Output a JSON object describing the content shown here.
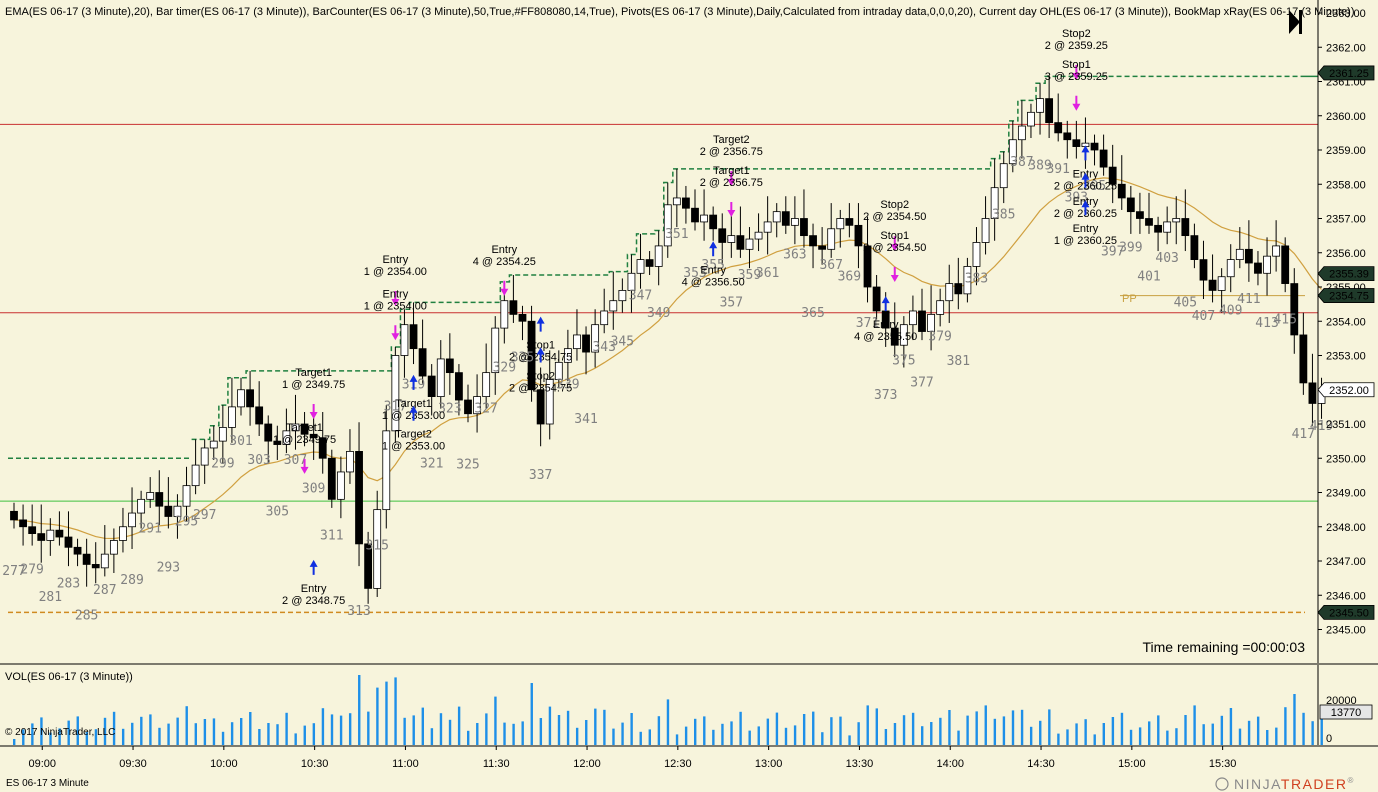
{
  "header": {
    "indicators": "EMA(ES 06-17 (3 Minute),20), Bar timer(ES 06-17 (3 Minute)), BarCounter(ES 06-17 (3 Minute),50,True,#FF808080,14,True), Pivots(ES 06-17 (3 Minute),Daily,Calculated from intraday data,0,0,0,20), Current day OHL(ES 06-17 (3 Minute)), BookMap xRay(ES 06-17 (3 Minute))"
  },
  "time_remaining": "Time remaining =00:00:03",
  "volume_panel": {
    "label": "VOL(ES 06-17 (3 Minute))",
    "current_tag": "13770",
    "ticks": [
      "20000",
      "0"
    ]
  },
  "copyright": "© 2017 NinjaTrader, LLC",
  "instrument_label": "ES 06-17  3 Minute",
  "brand": {
    "ninja": "NINJA",
    "trader": "TRADER",
    "reg": "®"
  },
  "pivot_label": "PP",
  "price_tags": [
    {
      "text": "2361.25",
      "price": 2361.25,
      "style": "dark"
    },
    {
      "text": "2355.39",
      "price": 2355.39,
      "style": "dark"
    },
    {
      "text": "2354.75",
      "price": 2354.75,
      "style": "dark"
    },
    {
      "text": "2352.00",
      "price": 2352.0,
      "style": "light"
    },
    {
      "text": "2345.50",
      "price": 2345.5,
      "style": "dark"
    }
  ],
  "chart_data": {
    "type": "candlestick",
    "instrument": "ES 06-17",
    "interval": "3 Minute",
    "ylim": [
      2344.6,
      2363.3
    ],
    "y_ticks": [
      "2345.00",
      "2346.00",
      "2347.00",
      "2348.00",
      "2349.00",
      "2350.00",
      "2351.00",
      "2352.00",
      "2353.00",
      "2354.00",
      "2355.00",
      "2356.00",
      "2357.00",
      "2358.00",
      "2359.00",
      "2360.00",
      "2361.00",
      "2362.00",
      "2363.00"
    ],
    "x_ticks": [
      "09:00",
      "09:30",
      "10:00",
      "10:30",
      "11:00",
      "11:30",
      "12:00",
      "12:30",
      "13:00",
      "13:30",
      "14:00",
      "14:30",
      "15:00",
      "15:30"
    ],
    "x_tick_bar_index": [
      3,
      13,
      23,
      33,
      43,
      53,
      63,
      73,
      83,
      93,
      103,
      113,
      123,
      133
    ],
    "reference_lines": {
      "day_high": 2361.25,
      "day_low": 2345.5,
      "day_open": 2350.0,
      "pivot_pp": 2354.75,
      "red_upper": 2359.75,
      "red_lower": 2354.25,
      "green": 2348.75
    },
    "price_series": [
      2348.2,
      2348.0,
      2347.8,
      2347.6,
      2347.9,
      2347.7,
      2347.4,
      2347.2,
      2346.9,
      2346.8,
      2347.2,
      2347.6,
      2348.0,
      2348.4,
      2348.8,
      2349.0,
      2348.6,
      2348.3,
      2348.6,
      2349.2,
      2349.8,
      2350.3,
      2350.5,
      2350.9,
      2351.5,
      2352.0,
      2351.5,
      2351.0,
      2350.5,
      2350.4,
      2350.8,
      2351.0,
      2350.7,
      2350.6,
      2350.0,
      2348.8,
      2349.6,
      2350.2,
      2347.5,
      2346.2,
      2348.5,
      2350.8,
      2353.0,
      2353.9,
      2353.2,
      2352.4,
      2351.8,
      2352.9,
      2352.5,
      2351.7,
      2351.3,
      2351.8,
      2352.5,
      2353.8,
      2354.6,
      2354.2,
      2354.0,
      2352.0,
      2351.0,
      2352.3,
      2352.8,
      2353.2,
      2353.6,
      2353.1,
      2353.9,
      2354.3,
      2354.6,
      2354.9,
      2355.4,
      2355.8,
      2355.6,
      2356.2,
      2357.4,
      2357.6,
      2357.3,
      2356.9,
      2357.1,
      2356.7,
      2356.3,
      2356.5,
      2356.1,
      2356.4,
      2356.6,
      2356.9,
      2357.2,
      2356.8,
      2357.0,
      2356.5,
      2356.2,
      2356.1,
      2356.7,
      2357.0,
      2356.8,
      2356.2,
      2355.0,
      2354.3,
      2353.8,
      2353.3,
      2353.9,
      2354.3,
      2353.7,
      2354.2,
      2354.6,
      2355.1,
      2354.8,
      2355.6,
      2356.3,
      2357.0,
      2357.9,
      2358.6,
      2359.3,
      2359.7,
      2360.1,
      2360.5,
      2359.8,
      2359.5,
      2359.3,
      2359.1,
      2359.2,
      2359.0,
      2358.5,
      2358.0,
      2357.6,
      2357.2,
      2357.0,
      2356.8,
      2356.6,
      2356.9,
      2357.0,
      2356.5,
      2355.8,
      2355.2,
      2354.9,
      2355.3,
      2355.8,
      2356.1,
      2355.7,
      2355.4,
      2355.9,
      2356.2,
      2355.1,
      2353.6,
      2352.2,
      2351.6,
      2352.0
    ],
    "bar_counter_labels": [
      "277",
      "279",
      "281",
      "283",
      "285",
      "287",
      "289",
      "291",
      "293",
      "295",
      "297",
      "299",
      "301",
      "303",
      "305",
      "307",
      "309",
      "311",
      "313",
      "315",
      "317",
      "319",
      "321",
      "323",
      "325",
      "327",
      "329",
      "335",
      "337",
      "339",
      "341",
      "343",
      "345",
      "347",
      "349",
      "351",
      "353",
      "355",
      "357",
      "359",
      "361",
      "363",
      "365",
      "367",
      "369",
      "371",
      "373",
      "375",
      "377",
      "379",
      "381",
      "383",
      "385",
      "387",
      "389",
      "391",
      "393",
      "395",
      "397",
      "399",
      "401",
      "403",
      "405",
      "407",
      "409",
      "411",
      "413",
      "415",
      "417",
      "419"
    ],
    "ema": "EMA(20)",
    "annotations": [
      {
        "text": "Entry\n2 @ 2348.75",
        "price": 2346.1,
        "bar": 33,
        "dir": "long-entry"
      },
      {
        "text": "Target1\n1 @ 2349.75",
        "price": 2352.4,
        "bar": 33,
        "dir": "short-exit"
      },
      {
        "text": "Target1\n1 @ 2349.75",
        "price": 2350.8,
        "bar": 32,
        "dir": "short-exit"
      },
      {
        "text": "Entry\n1 @ 2354.00",
        "price": 2355.7,
        "bar": 42,
        "dir": "short-entry"
      },
      {
        "text": "Entry\n1 @ 2354.00",
        "price": 2354.7,
        "bar": 42,
        "dir": "short-entry"
      },
      {
        "text": "Target1\n1 @ 2353.00",
        "price": 2351.5,
        "bar": 44,
        "dir": "long-exit"
      },
      {
        "text": "Target2\n1 @ 2353.00",
        "price": 2350.6,
        "bar": 44,
        "dir": "long-exit"
      },
      {
        "text": "Entry\n4 @ 2354.25",
        "price": 2356.0,
        "bar": 54,
        "dir": "short-entry"
      },
      {
        "text": "Stop1\n2 @ 2354.75",
        "price": 2353.2,
        "bar": 58,
        "dir": "long-exit"
      },
      {
        "text": "Stop2\n2 @ 2354.75",
        "price": 2352.3,
        "bar": 58,
        "dir": "long-exit"
      },
      {
        "text": "Target2\n2 @ 2356.75",
        "price": 2359.2,
        "bar": 79,
        "dir": "short-exit"
      },
      {
        "text": "Target1\n2 @ 2356.75",
        "price": 2358.3,
        "bar": 79,
        "dir": "short-exit"
      },
      {
        "text": "Entry\n4 @ 2356.50",
        "price": 2355.4,
        "bar": 77,
        "dir": "long-entry"
      },
      {
        "text": "Stop2\n2 @ 2354.50",
        "price": 2357.3,
        "bar": 97,
        "dir": "short-exit"
      },
      {
        "text": "Stop1\n2 @ 2354.50",
        "price": 2356.4,
        "bar": 97,
        "dir": "short-exit"
      },
      {
        "text": "Entry\n4 @ 2355.50",
        "price": 2353.8,
        "bar": 96,
        "dir": "long-entry"
      },
      {
        "text": "Stop2\n2 @ 2359.25",
        "price": 2362.3,
        "bar": 117,
        "dir": "short-exit"
      },
      {
        "text": "Stop1\n3 @ 2359.25",
        "price": 2361.4,
        "bar": 117,
        "dir": "short-exit"
      },
      {
        "text": "Entry\n2 @ 2360.25",
        "price": 2358.2,
        "bar": 118,
        "dir": "long-entry"
      },
      {
        "text": "Entry\n2 @ 2360.25",
        "price": 2357.4,
        "bar": 118,
        "dir": "long-entry"
      },
      {
        "text": "Entry\n1 @ 2360.25",
        "price": 2356.6,
        "bar": 118,
        "dir": "long-entry"
      }
    ]
  }
}
